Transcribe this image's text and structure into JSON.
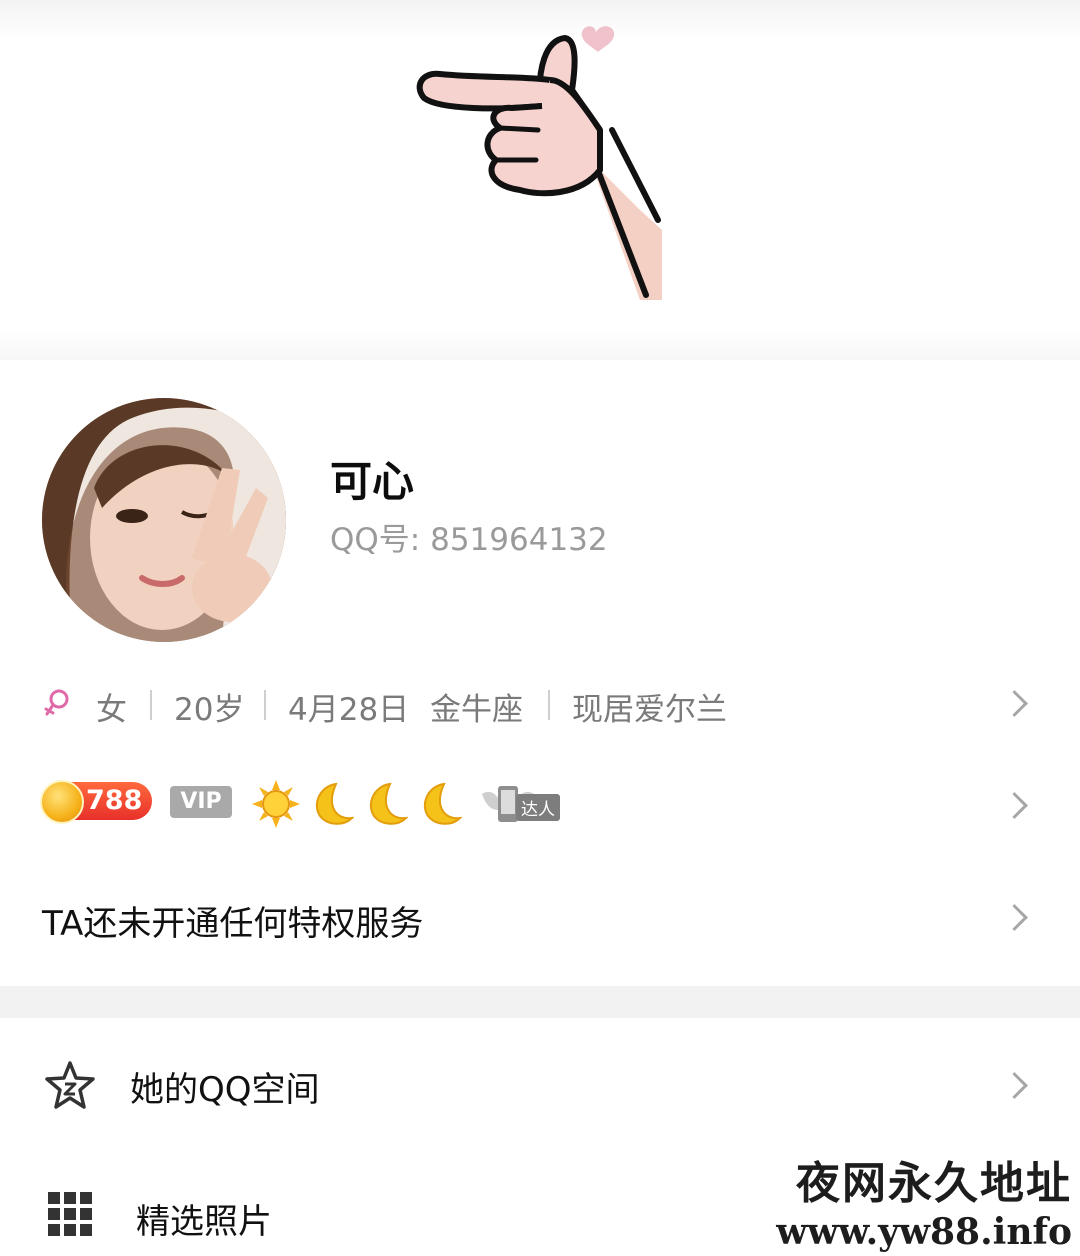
{
  "profile": {
    "name": "可心",
    "qq_label": "QQ号:",
    "qq_number": "851964132"
  },
  "info": {
    "gender": "女",
    "age": "20岁",
    "birthday": "4月28日",
    "zodiac": "金牛座",
    "location": "现居爱尔兰"
  },
  "badges": {
    "level": "788",
    "vip": "VIP",
    "talent": "达人"
  },
  "privilege": {
    "text": "TA还未开通任何特权服务"
  },
  "menu": {
    "qzone": "她的QQ空间",
    "photos": "精选照片"
  },
  "watermark": {
    "line1": "夜网永久地址",
    "line2": "www.yw88.info"
  },
  "colors": {
    "gender_pink": "#e06aa8",
    "level_red": "#e8302a",
    "vip_gray": "#a9a9a9",
    "moon_yellow": "#f5c21a"
  }
}
